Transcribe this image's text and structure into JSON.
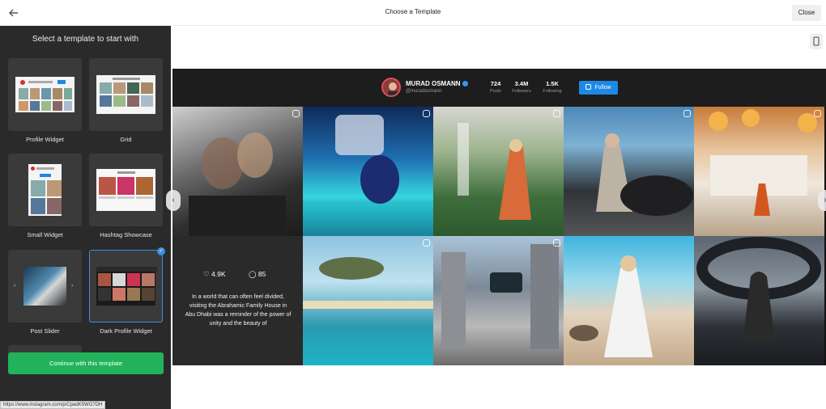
{
  "topbar": {
    "title": "Choose a Template",
    "close_label": "Close"
  },
  "sidebar": {
    "title": "Select a template to start with",
    "templates": [
      {
        "label": "Profile Widget",
        "selected": false
      },
      {
        "label": "Grid",
        "selected": false
      },
      {
        "label": "Small Widget",
        "selected": false
      },
      {
        "label": "Hashtag Showcase",
        "selected": false
      },
      {
        "label": "Post Slider",
        "selected": false
      },
      {
        "label": "Dark Profile Widget",
        "selected": true
      },
      {
        "label": "",
        "selected": false
      }
    ],
    "continue_label": "Continue with this template"
  },
  "status_url": "https://www.instagram.com/p/CpadK5WO7DH",
  "widget": {
    "profile": {
      "name": "MURAD OSMANN",
      "handle": "@muradosmann",
      "stats": [
        {
          "value": "724",
          "label": "Posts"
        },
        {
          "value": "3.4M",
          "label": "Followers"
        },
        {
          "value": "1.5K",
          "label": "Following"
        }
      ],
      "follow_label": "Follow"
    },
    "hover_post": {
      "likes": "4.9K",
      "comments": "85",
      "caption": "In a world that can often feel divided, visiting the Abrahamic Family House in Abu Dhabi was a reminder of the power of unity and the beauty of"
    }
  },
  "colors": {
    "accent_green": "#22b35a",
    "accent_blue": "#1e88e5",
    "selected_border": "#3b8de0"
  }
}
